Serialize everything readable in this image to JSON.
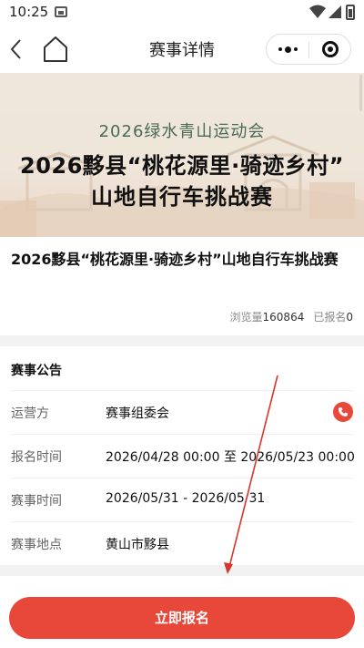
{
  "status_bar": {
    "time": "10:25",
    "icons": [
      "image-icon",
      "wifi-icon",
      "signal-icon",
      "battery-icon"
    ]
  },
  "nav": {
    "title": "赛事详情",
    "back_icon": "chevron-left-icon",
    "home_icon": "home-icon",
    "menu_icon": "more-dots-icon",
    "close_icon": "target-close-icon"
  },
  "banner": {
    "subtitle": "2026绿水青山运动会",
    "title_line1": "2026黟县“桃花源里·骑迹乡村”",
    "title_line2": "山地自行车挑战赛"
  },
  "event": {
    "name": "2026黟县“桃花源里·骑迹乡村”山地自行车挑战赛",
    "views_label": "浏览量",
    "views_value": "160864",
    "signed_label": "已报名",
    "signed_value": "0"
  },
  "details": {
    "notice_title": "赛事公告",
    "rows": [
      {
        "label": "运营方",
        "value": "赛事组委会",
        "icon": "phone-icon"
      },
      {
        "label": "报名时间",
        "value": "2026/04/28 00:00 至 2026/05/23 00:00"
      },
      {
        "label": "赛事时间",
        "value": "2026/05/31 - 2026/05/31"
      },
      {
        "label": "赛事地点",
        "value": "黄山市黟县"
      }
    ]
  },
  "bottom": {
    "signup_label": "立即报名"
  },
  "colors": {
    "accent": "#e8483a",
    "banner_subtitle": "#4a6a55",
    "annotation_arrow": "#d9352b"
  }
}
